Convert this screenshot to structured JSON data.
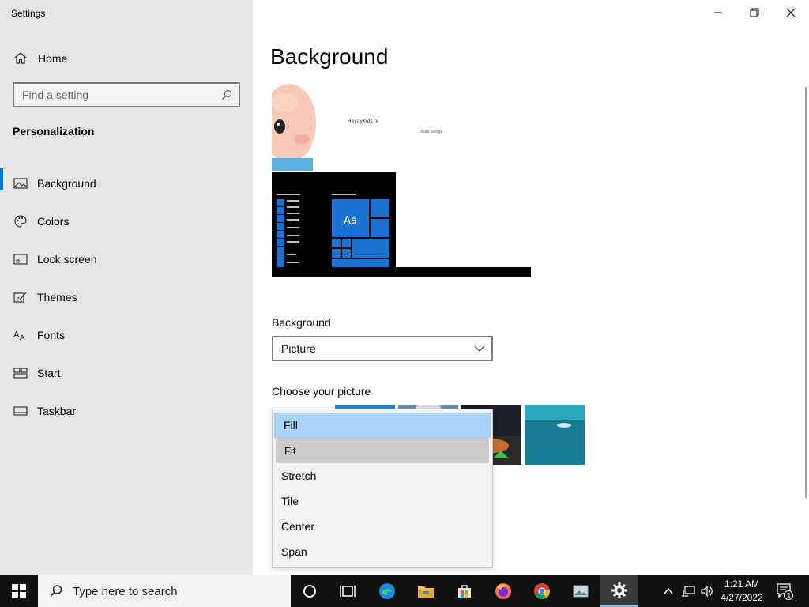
{
  "window": {
    "title": "Settings"
  },
  "sidebar": {
    "home_label": "Home",
    "search_placeholder": "Find a setting",
    "section_title": "Personalization",
    "items": [
      {
        "label": "Background",
        "icon": "picture-icon",
        "active": true
      },
      {
        "label": "Colors",
        "icon": "palette-icon"
      },
      {
        "label": "Lock screen",
        "icon": "lock-screen-icon"
      },
      {
        "label": "Themes",
        "icon": "themes-icon"
      },
      {
        "label": "Fonts",
        "icon": "fonts-icon"
      },
      {
        "label": "Start",
        "icon": "start-icon"
      },
      {
        "label": "Taskbar",
        "icon": "taskbar-icon"
      }
    ]
  },
  "main": {
    "title": "Background",
    "preview": {
      "wallpaper_text_1": "HeyayKidsTV",
      "wallpaper_text_2": "Kids Songs",
      "tile_label": "Aa"
    },
    "background_label": "Background",
    "background_value": "Picture",
    "choose_picture_label": "Choose your picture",
    "fit_options": [
      "Fill",
      "Fit",
      "Stretch",
      "Tile",
      "Center",
      "Span"
    ],
    "fit_selected": "Fill",
    "fit_hovered": "Fit"
  },
  "taskbar": {
    "search_placeholder": "Type here to search",
    "time": "1:21 AM",
    "date": "4/27/2022",
    "notification_count": "1"
  },
  "colors": {
    "accent": "#0078d7",
    "sidebar_bg": "#e6e6e6",
    "selected_option": "#aad4fa",
    "hover_option": "#cccccc",
    "taskbar": "#101010"
  }
}
